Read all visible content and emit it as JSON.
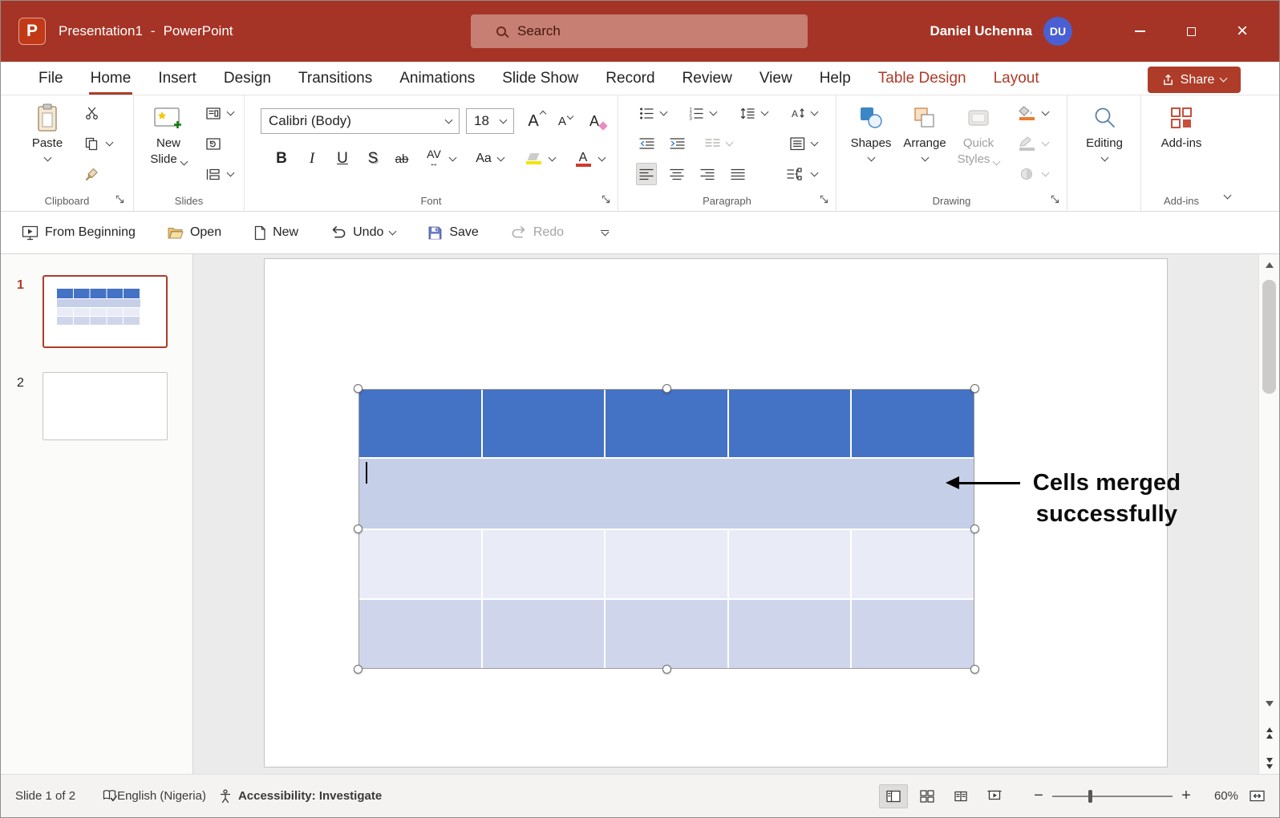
{
  "colors": {
    "titlebar_bg": "#A53426",
    "accent": "#AE3C28",
    "search_bg": "#C67F72",
    "avatar_bg": "#4A5FD3",
    "table_header": "#4472C4",
    "table_merged": "#C6CFE8",
    "table_light": "#E9EBF6",
    "table_band": "#CFD6EC",
    "highlight_yellow": "#F1E500",
    "font_color_red": "#D03A2B"
  },
  "titlebar": {
    "logo_letter": "P",
    "document_title": "Presentation1",
    "title_separator": "-",
    "app_name": "PowerPoint",
    "search_placeholder": "Search",
    "user_name": "Daniel Uchenna",
    "avatar_initials": "DU"
  },
  "tabs": {
    "items": [
      "File",
      "Home",
      "Insert",
      "Design",
      "Transitions",
      "Animations",
      "Slide Show",
      "Record",
      "Review",
      "View",
      "Help"
    ],
    "contextual": [
      "Table Design",
      "Layout"
    ],
    "share_label": "Share"
  },
  "ribbon": {
    "clipboard": {
      "paste_label": "Paste",
      "group_label": "Clipboard"
    },
    "slides": {
      "new_label": "New",
      "slide_label": "Slide",
      "group_label": "Slides"
    },
    "font": {
      "family_value": "Calibri (Body)",
      "size_value": "18",
      "bold": "B",
      "italic": "I",
      "underline": "U",
      "shadow": "S",
      "strikethrough": "ab",
      "char_spacing": "AV",
      "spacing_arrow": "↔",
      "change_case": "Aa",
      "grow_letter": "A",
      "shrink_letter": "A",
      "clear_letter": "A",
      "fontcolor_letter": "A",
      "group_label": "Font"
    },
    "paragraph": {
      "group_label": "Paragraph"
    },
    "drawing": {
      "shapes_label": "Shapes",
      "arrange_label": "Arrange",
      "quick_label": "Quick",
      "styles_label": "Styles",
      "group_label": "Drawing"
    },
    "editing": {
      "label": "Editing"
    },
    "addins": {
      "button_label": "Add-ins",
      "group_label": "Add-ins"
    }
  },
  "qat": {
    "from_beginning": "From Beginning",
    "open": "Open",
    "new": "New",
    "undo": "Undo",
    "save": "Save",
    "redo": "Redo"
  },
  "slide_panel": {
    "slide1_number": "1",
    "slide2_number": "2"
  },
  "canvas": {
    "annotation_line1": "Cells merged",
    "annotation_line2": "successfully",
    "table": {
      "columns": 5,
      "rows": [
        {
          "name": "header",
          "cells": 5,
          "fill": "table_header"
        },
        {
          "name": "merged-row",
          "cells": 1,
          "fill": "table_merged"
        },
        {
          "name": "band-light",
          "cells": 5,
          "fill": "table_light"
        },
        {
          "name": "band-medium",
          "cells": 5,
          "fill": "table_band"
        }
      ]
    }
  },
  "statusbar": {
    "slide_indicator": "Slide 1 of 2",
    "language": "English (Nigeria)",
    "accessibility": "Accessibility: Investigate",
    "zoom_value": "60%"
  }
}
